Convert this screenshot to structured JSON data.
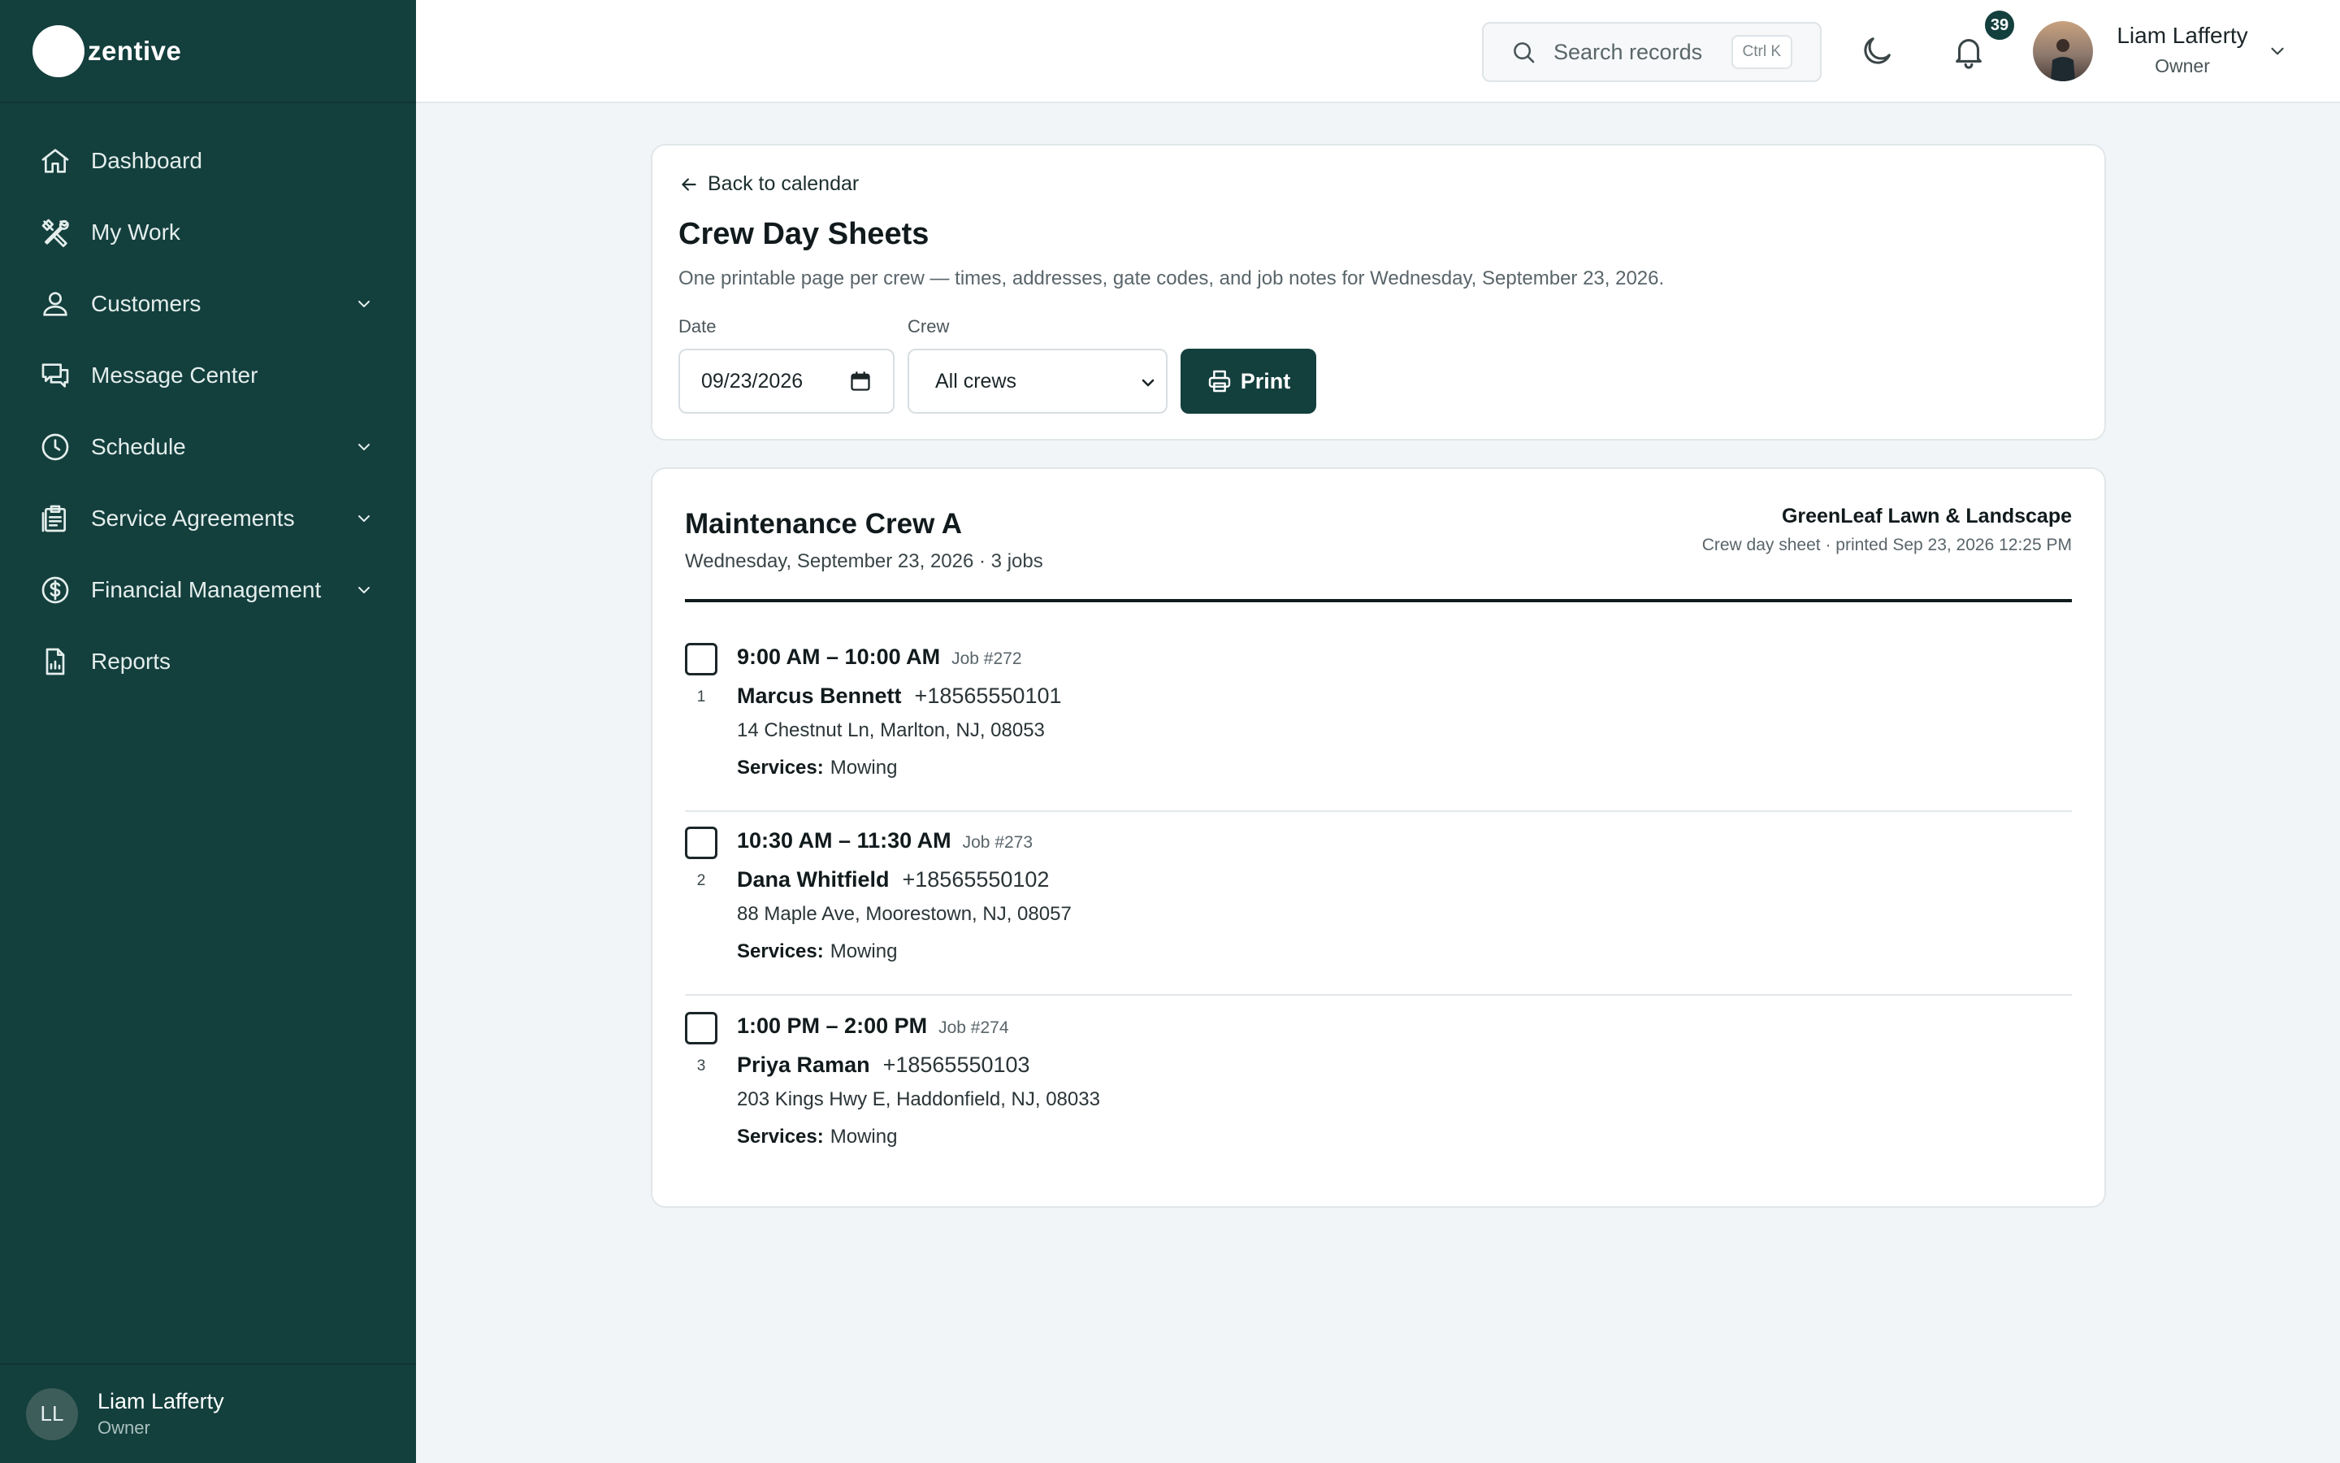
{
  "brand": {
    "name": "zentive"
  },
  "sidebar": {
    "items": [
      {
        "label": "Dashboard",
        "icon": "home-icon",
        "expandable": false
      },
      {
        "label": "My Work",
        "icon": "tools-icon",
        "expandable": false
      },
      {
        "label": "Customers",
        "icon": "users-icon",
        "expandable": true
      },
      {
        "label": "Message Center",
        "icon": "chat-icon",
        "expandable": false
      },
      {
        "label": "Schedule",
        "icon": "clock-icon",
        "expandable": true
      },
      {
        "label": "Service Agreements",
        "icon": "clipboard-icon",
        "expandable": true
      },
      {
        "label": "Financial Management",
        "icon": "dollar-icon",
        "expandable": true
      },
      {
        "label": "Reports",
        "icon": "report-icon",
        "expandable": false
      }
    ],
    "user": {
      "initials": "LL",
      "name": "Liam Lafferty",
      "role": "Owner"
    }
  },
  "topbar": {
    "search_placeholder": "Search records",
    "search_shortcut": "Ctrl K",
    "notification_count": "39",
    "user": {
      "name": "Liam Lafferty",
      "role": "Owner"
    }
  },
  "header": {
    "back_label": "Back to calendar",
    "title": "Crew Day Sheets",
    "subtitle": "One printable page per crew — times, addresses, gate codes, and job notes for Wednesday, September 23, 2026.",
    "date_label": "Date",
    "date_value": "09/23/2026",
    "crew_label": "Crew",
    "crew_value": "All crews",
    "print_label": "Print"
  },
  "crew_sheet": {
    "crew_name": "Maintenance Crew A",
    "meta": "Wednesday, September 23, 2026 · 3 jobs",
    "company": "GreenLeaf Lawn & Landscape",
    "printed": "Crew day sheet · printed Sep 23, 2026 12:25 PM",
    "services_label": "Services:",
    "jobs": [
      {
        "num": "1",
        "time": "9:00 AM – 10:00 AM",
        "job_id": "Job #272",
        "client": "Marcus Bennett",
        "phone": "+18565550101",
        "address": "14 Chestnut Ln, Marlton, NJ, 08053",
        "services": "Mowing"
      },
      {
        "num": "2",
        "time": "10:30 AM – 11:30 AM",
        "job_id": "Job #273",
        "client": "Dana Whitfield",
        "phone": "+18565550102",
        "address": "88 Maple Ave, Moorestown, NJ, 08057",
        "services": "Mowing"
      },
      {
        "num": "3",
        "time": "1:00 PM – 2:00 PM",
        "job_id": "Job #274",
        "client": "Priya Raman",
        "phone": "+18565550103",
        "address": "203 Kings Hwy E, Haddonfield, NJ, 08033",
        "services": "Mowing"
      }
    ]
  },
  "colors": {
    "sidebar_bg": "#133f3d",
    "accent": "#133f3d",
    "page_bg": "#f2f5f7"
  }
}
